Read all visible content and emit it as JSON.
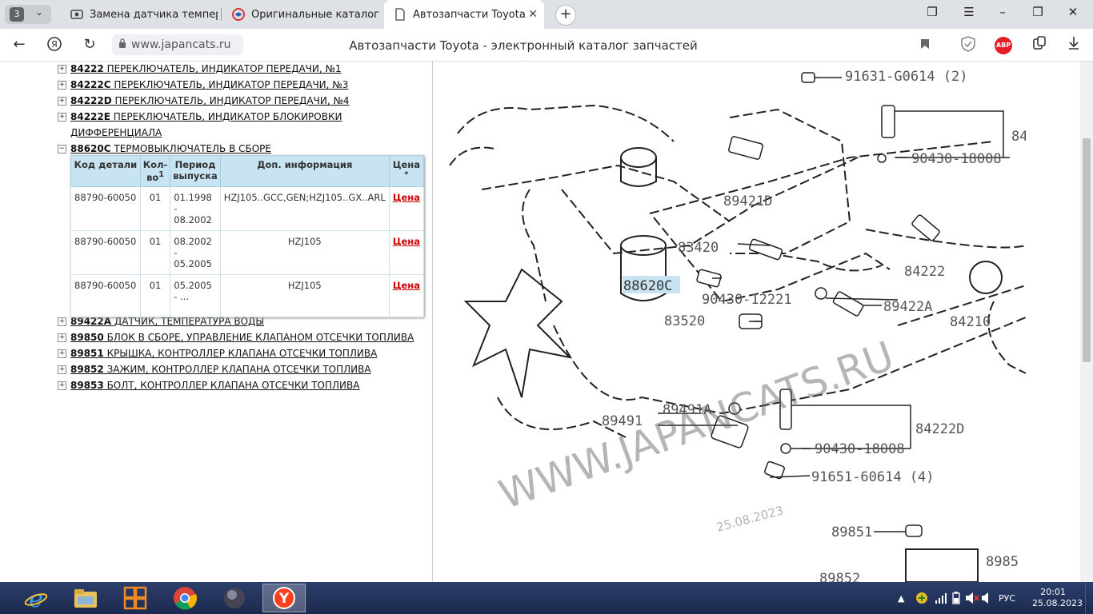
{
  "tabbar": {
    "tab_count": "3",
    "tabs": [
      {
        "title": "Замена датчика температ",
        "icon": "page-icon"
      },
      {
        "title": "Оригинальные каталоги",
        "icon": "catalog-icon"
      },
      {
        "title": "Автозапчасти Toyota - э",
        "icon": "document-icon",
        "active": true
      }
    ]
  },
  "addressbar": {
    "url": "www.japancats.ru",
    "page_title": "Автозапчасти Toyota - электронный каталог запчастей",
    "abp_label": "ABP"
  },
  "tree": {
    "items_top": [
      {
        "code": "84222",
        "name": "ПЕРЕКЛЮЧАТЕЛЬ, ИНДИКАТОР ПЕРЕДАЧИ, №1"
      },
      {
        "code": "84222C",
        "name": "ПЕРЕКЛЮЧАТЕЛЬ, ИНДИКАТОР ПЕРЕДАЧИ, №3"
      },
      {
        "code": "84222D",
        "name": "ПЕРЕКЛЮЧАТЕЛЬ, ИНДИКАТОР ПЕРЕДАЧИ, №4"
      },
      {
        "code": "84222E",
        "name": "ПЕРЕКЛЮЧАТЕЛЬ, ИНДИКАТОР БЛОКИРОВКИ",
        "name_cont": "ДИФФЕРЕНЦИАЛА"
      }
    ],
    "expanded": {
      "code": "88620C",
      "name": "ТЕРМОВЫКЛЮЧАТЕЛЬ В СБОРЕ"
    },
    "items_bottom": [
      {
        "code": "89422A",
        "name": "ДАТЧИК, ТЕМПЕРАТУРА ВОДЫ"
      },
      {
        "code": "89850",
        "name": "БЛОК В СБОРЕ, УПРАВЛЕНИЕ КЛАПАНОМ ОТСЕЧКИ ТОПЛИВА"
      },
      {
        "code": "89851",
        "name": "КРЫШКА, КОНТРОЛЛЕР КЛАПАНА ОТСЕЧКИ ТОПЛИВА"
      },
      {
        "code": "89852",
        "name": "ЗАЖИМ, КОНТРОЛЛЕР КЛАПАНА ОТСЕЧКИ ТОПЛИВА"
      },
      {
        "code": "89853",
        "name": "БОЛТ, КОНТРОЛЛЕР КЛАПАНА ОТСЕЧКИ ТОПЛИВА"
      }
    ]
  },
  "table": {
    "headers": {
      "code": "Код детали",
      "qty": "Кол-во",
      "qty_sup": "1",
      "period": "Период выпуска",
      "info": "Доп. информация",
      "price": "Цена",
      "price_sup": "*"
    },
    "rows": [
      {
        "code": "88790-60050",
        "qty": "01",
        "from": "01.1998",
        "dash": "-",
        "to": "08.2002",
        "info": "HZJ105..GCC,GEN;HZJ105..GX..ARL",
        "price": "Цена"
      },
      {
        "code": "88790-60050",
        "qty": "01",
        "from": "08.2002",
        "dash": "-",
        "to": "05.2005",
        "info": "HZJ105",
        "price": "Цена"
      },
      {
        "code": "88790-60050",
        "qty": "01",
        "from": "05.2005",
        "dash": "- ...",
        "to": "",
        "info": "HZJ105",
        "price": "Цена"
      }
    ]
  },
  "diagram": {
    "labels": [
      "91631-G0614 (2)",
      "90430-18008",
      "89421D",
      "83420",
      "88620C",
      "90430-12221",
      "89422A",
      "83520",
      "84222",
      "84210",
      "89491A",
      "89491",
      "84222D",
      "90430-18008",
      "91651-60614 (4)",
      "89851",
      "89852",
      "8985",
      "84"
    ],
    "watermark": "WWW.JAPANCATS.RU",
    "date": "25.08.2023"
  },
  "taskbar": {
    "lang": "РУС",
    "time": "20:01",
    "date": "25.08.2023"
  }
}
